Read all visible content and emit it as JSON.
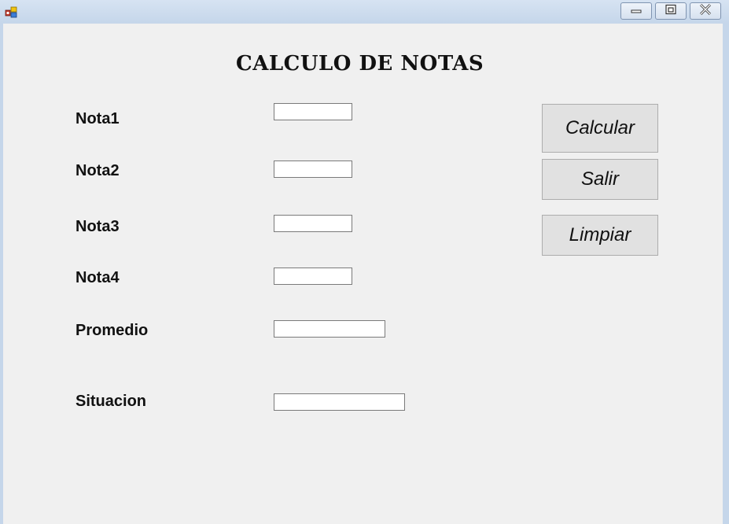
{
  "window": {
    "title": "",
    "icon": "winforms-app-icon",
    "controls": {
      "minimize_icon": "minimize-icon",
      "maximize_icon": "maximize-icon",
      "close_icon": "close-icon"
    }
  },
  "form": {
    "heading": "CALCULO DE NOTAS",
    "fields": {
      "nota1": {
        "label": "Nota1",
        "value": ""
      },
      "nota2": {
        "label": "Nota2",
        "value": ""
      },
      "nota3": {
        "label": "Nota3",
        "value": ""
      },
      "nota4": {
        "label": "Nota4",
        "value": ""
      },
      "promedio": {
        "label": "Promedio",
        "value": ""
      },
      "situacion": {
        "label": "Situacion",
        "value": ""
      }
    },
    "buttons": {
      "calcular": "Calcular",
      "salir": "Salir",
      "limpiar": "Limpiar"
    }
  },
  "colors": {
    "client_background": "#f0f0f0",
    "button_background": "#e1e1e1",
    "titlebar": "#c9d9ec"
  }
}
